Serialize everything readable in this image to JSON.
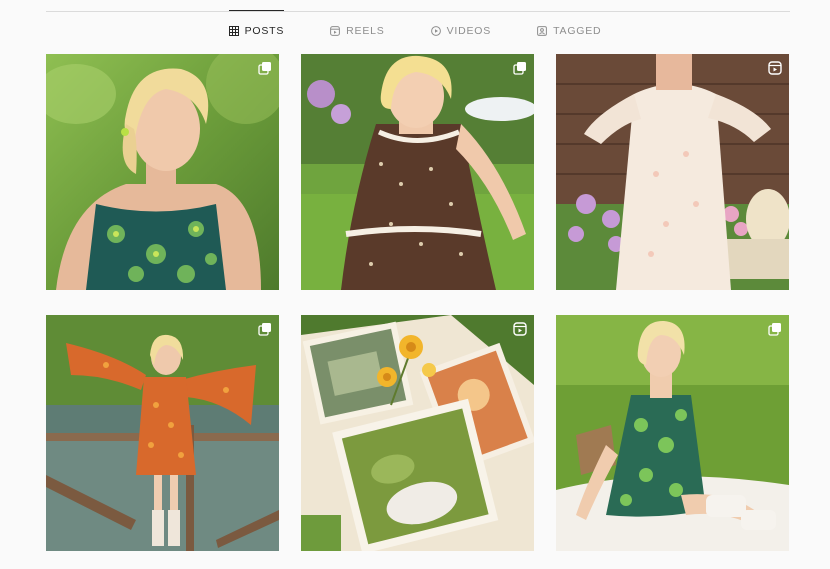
{
  "tabs": [
    {
      "label": "POSTS",
      "icon": "grid-icon",
      "active": true
    },
    {
      "label": "REELS",
      "icon": "reels-icon",
      "active": false
    },
    {
      "label": "VIDEOS",
      "icon": "play-icon",
      "active": false
    },
    {
      "label": "TAGGED",
      "icon": "tagged-icon",
      "active": false
    }
  ],
  "posts": [
    {
      "badge": "carousel-icon"
    },
    {
      "badge": "carousel-icon"
    },
    {
      "badge": "reels-icon"
    },
    {
      "badge": "carousel-icon"
    },
    {
      "badge": "reels-icon"
    },
    {
      "badge": "carousel-icon"
    }
  ],
  "colors": {
    "active_tab": "#262626",
    "inactive_tab": "#8e8e8e",
    "divider": "#dbdbdb",
    "background": "#fafafa"
  }
}
